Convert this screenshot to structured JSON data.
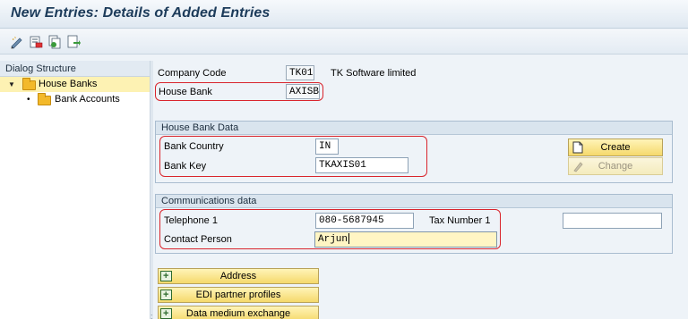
{
  "window": {
    "title": "New Entries: Details of Added Entries"
  },
  "toolbar": {
    "icons": [
      "edit-pencil-icon",
      "delete-row-icon",
      "copy-entry-icon",
      "export-icon"
    ]
  },
  "dialog_structure": {
    "header": "Dialog Structure",
    "items": [
      {
        "label": "House Banks",
        "selected": true,
        "expanded": true
      },
      {
        "label": "Bank Accounts",
        "selected": false
      }
    ]
  },
  "header_fields": {
    "company_code": {
      "label": "Company Code",
      "value": "TK01",
      "description": "TK Software limited"
    },
    "house_bank": {
      "label": "House Bank",
      "value": "AXISB"
    }
  },
  "house_bank_data": {
    "title": "House Bank Data",
    "bank_country": {
      "label": "Bank Country",
      "value": "IN"
    },
    "bank_key": {
      "label": "Bank Key",
      "value": "TKAXIS01"
    },
    "create_label": "Create",
    "change_label": "Change"
  },
  "communications": {
    "title": "Communications data",
    "telephone": {
      "label": "Telephone 1",
      "value": "080-5687945"
    },
    "tax_number": {
      "label": "Tax Number 1",
      "value": ""
    },
    "contact_person": {
      "label": "Contact Person",
      "value": "Arjun"
    }
  },
  "nav_buttons": [
    {
      "label": "Address"
    },
    {
      "label": "EDI partner profiles"
    },
    {
      "label": "Data medium exchange"
    }
  ],
  "colors": {
    "highlight_red": "#d9252d",
    "button_yellow": "#f5d96c",
    "title_blue": "#1c3b5a"
  }
}
